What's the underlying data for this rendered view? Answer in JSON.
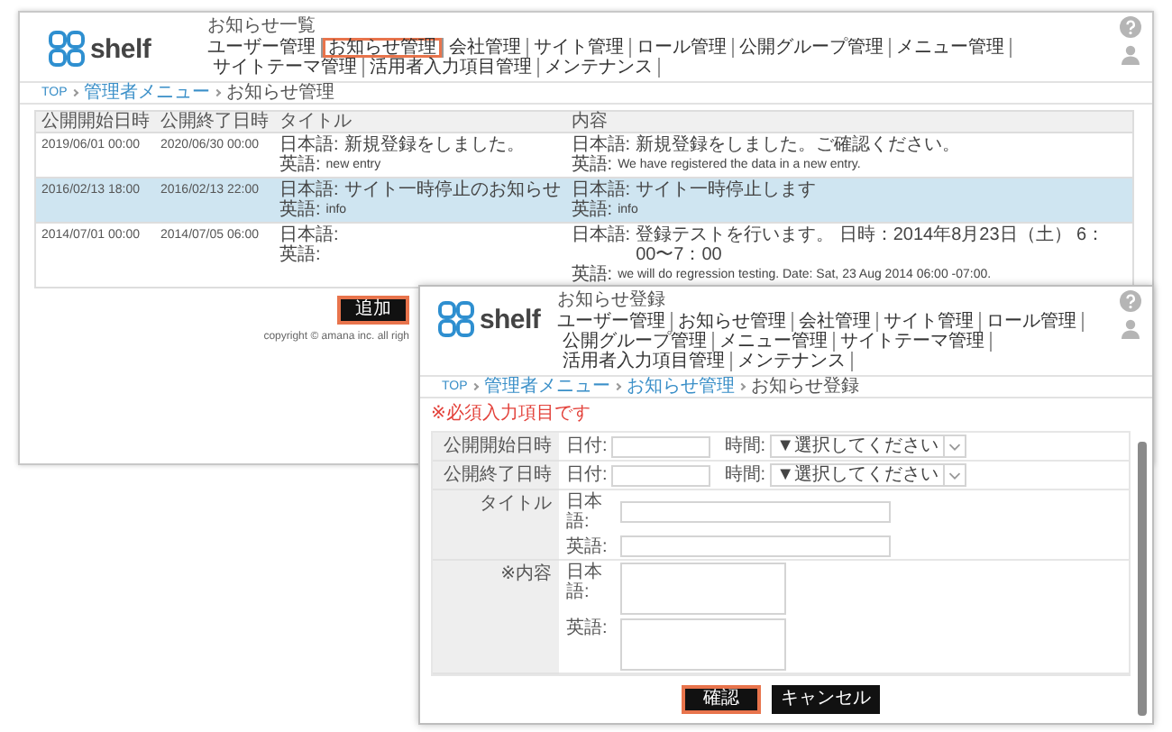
{
  "back_window": {
    "brand": "shelf",
    "title": "お知らせ一覧",
    "nav": [
      {
        "label": "ユーザー管理",
        "highlighted": false
      },
      {
        "label": "お知らせ管理",
        "highlighted": true
      },
      {
        "label": "会社管理",
        "highlighted": false
      },
      {
        "label": "サイト管理",
        "highlighted": false
      },
      {
        "label": "ロール管理",
        "highlighted": false
      },
      {
        "label": "公開グループ管理",
        "highlighted": false
      },
      {
        "label": "メニュー管理",
        "highlighted": false
      },
      {
        "label": "サイトテーマ管理",
        "highlighted": false
      },
      {
        "label": "活用者入力項目管理",
        "highlighted": false
      },
      {
        "label": "メンテナンス",
        "highlighted": false
      }
    ],
    "breadcrumb": [
      {
        "label": "TOP",
        "kind": "link"
      },
      {
        "label": "管理者メニュー",
        "kind": "link"
      },
      {
        "label": "お知らせ管理",
        "kind": "current"
      }
    ],
    "table": {
      "columns": [
        "公開開始日時",
        "公開終了日時",
        "タイトル",
        "内容"
      ],
      "rows": [
        {
          "selected": false,
          "start": "2019/06/01 00:00",
          "end": "2020/06/30 00:00",
          "title": [
            {
              "lang": "日本語:",
              "text": "新規登録をしました。"
            },
            {
              "lang": "英語:",
              "text": "new entry"
            }
          ],
          "content": [
            {
              "lang": "日本語:",
              "text": "新規登録をしました。ご確認ください。"
            },
            {
              "lang": "英語:",
              "text": "We have registered the data in a new entry."
            }
          ]
        },
        {
          "selected": true,
          "start": "2016/02/13 18:00",
          "end": "2016/02/13 22:00",
          "title": [
            {
              "lang": "日本語:",
              "text": "サイト一時停止のお知らせ"
            },
            {
              "lang": "英語:",
              "text": "info"
            }
          ],
          "content": [
            {
              "lang": "日本語:",
              "text": "サイト一時停止します"
            },
            {
              "lang": "英語:",
              "text": "info"
            }
          ]
        },
        {
          "selected": false,
          "start": "2014/07/01 00:00",
          "end": "2014/07/05 06:00",
          "title": [
            {
              "lang": "日本語:"
            },
            {
              "lang": "英語:"
            }
          ],
          "content": [
            {
              "lang": "日本語:",
              "text": "登録テストを行います。 日時：2014年8月23日（土） 6：00〜7：00"
            },
            {
              "lang": "英語:",
              "text": "we will do regression testing. Date: Sat, 23 Aug 2014 06:00 -07:00."
            }
          ]
        }
      ]
    },
    "button": {
      "label": "追加",
      "highlighted": true
    },
    "copyright": "copyright © amana inc. all righ"
  },
  "front_window": {
    "brand": "shelf",
    "title": "お知らせ登録",
    "nav": [
      {
        "label": "ユーザー管理",
        "highlighted": false
      },
      {
        "label": "お知らせ管理",
        "highlighted": false
      },
      {
        "label": "会社管理",
        "highlighted": false
      },
      {
        "label": "サイト管理",
        "highlighted": false
      },
      {
        "label": "ロール管理",
        "highlighted": false
      },
      {
        "label": "公開グループ管理",
        "highlighted": false
      },
      {
        "label": "メニュー管理",
        "highlighted": false
      },
      {
        "label": "サイトテーマ管理",
        "highlighted": false
      },
      {
        "label": "活用者入力項目管理",
        "highlighted": false
      },
      {
        "label": "メンテナンス",
        "highlighted": false
      }
    ],
    "breadcrumb": [
      {
        "label": "TOP",
        "kind": "link"
      },
      {
        "label": "管理者メニュー",
        "kind": "link"
      },
      {
        "label": "お知らせ管理",
        "kind": "link"
      },
      {
        "label": "お知らせ登録",
        "kind": "current"
      }
    ],
    "required_note": "※必須入力項目です",
    "form": [
      {
        "kind": "datetime",
        "label": "公開開始日時",
        "date_label": "日付:",
        "time_label": "時間:",
        "time_value": "▼選択してください"
      },
      {
        "kind": "datetime",
        "label": "公開終了日時",
        "date_label": "日付:",
        "time_label": "時間:",
        "time_value": "▼選択してください"
      },
      {
        "kind": "text",
        "label": "タイトル",
        "fields": [
          "日本語:",
          "英語:"
        ]
      },
      {
        "kind": "textarea",
        "label": "※内容",
        "fields": [
          "日本語:",
          "英語:"
        ]
      }
    ],
    "buttons": [
      {
        "label": "確認",
        "highlighted": true
      },
      {
        "label": "キャンセル",
        "highlighted": false
      }
    ]
  }
}
